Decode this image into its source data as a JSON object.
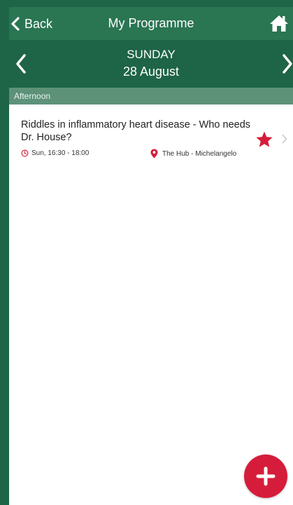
{
  "nav": {
    "back_label": "Back",
    "title": "My Programme"
  },
  "date": {
    "day": "SUNDAY",
    "date": "28 August"
  },
  "section": {
    "label": "Afternoon"
  },
  "session": {
    "title": "Riddles in inflammatory heart disease - Who needs Dr. House?",
    "time": "Sun, 16:30 - 18:00",
    "location": "The Hub - Michelangelo",
    "favourite": true
  },
  "colors": {
    "primary": "#1e6446",
    "navbar": "#2a7552",
    "section": "#5d9279",
    "accent": "#d61c3b"
  },
  "icons": {
    "back": "chevron-left-icon",
    "home": "home-icon",
    "prev": "chevron-left-icon",
    "next": "chevron-right-icon",
    "time": "clock-icon",
    "location": "map-pin-icon",
    "favourite": "star-icon",
    "add": "plus-icon"
  }
}
